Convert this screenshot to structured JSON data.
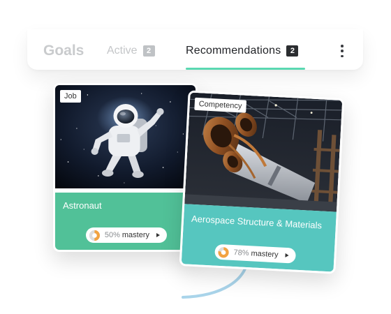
{
  "tabs": {
    "goals_label": "Goals",
    "active": {
      "label": "Active",
      "count": "2"
    },
    "recommendations": {
      "label": "Recommendations",
      "count": "2"
    }
  },
  "cards": [
    {
      "type": "Job",
      "title": "Astronaut",
      "mastery_pct": "50%",
      "mastery_word": "mastery",
      "mastery_fraction": 0.5,
      "color": "#51c198",
      "image": "astronaut-in-space-photo"
    },
    {
      "type": "Competency",
      "title": "Aerospace Structure & Materials",
      "mastery_pct": "78%",
      "mastery_word": "mastery",
      "mastery_fraction": 0.78,
      "color": "#56c6bf",
      "image": "rocket-engine-hangar-photo"
    }
  ],
  "colors": {
    "accent_underline": "#5ad8b1",
    "donut_fill": "#f2a341",
    "donut_track": "#dcdcdc"
  }
}
